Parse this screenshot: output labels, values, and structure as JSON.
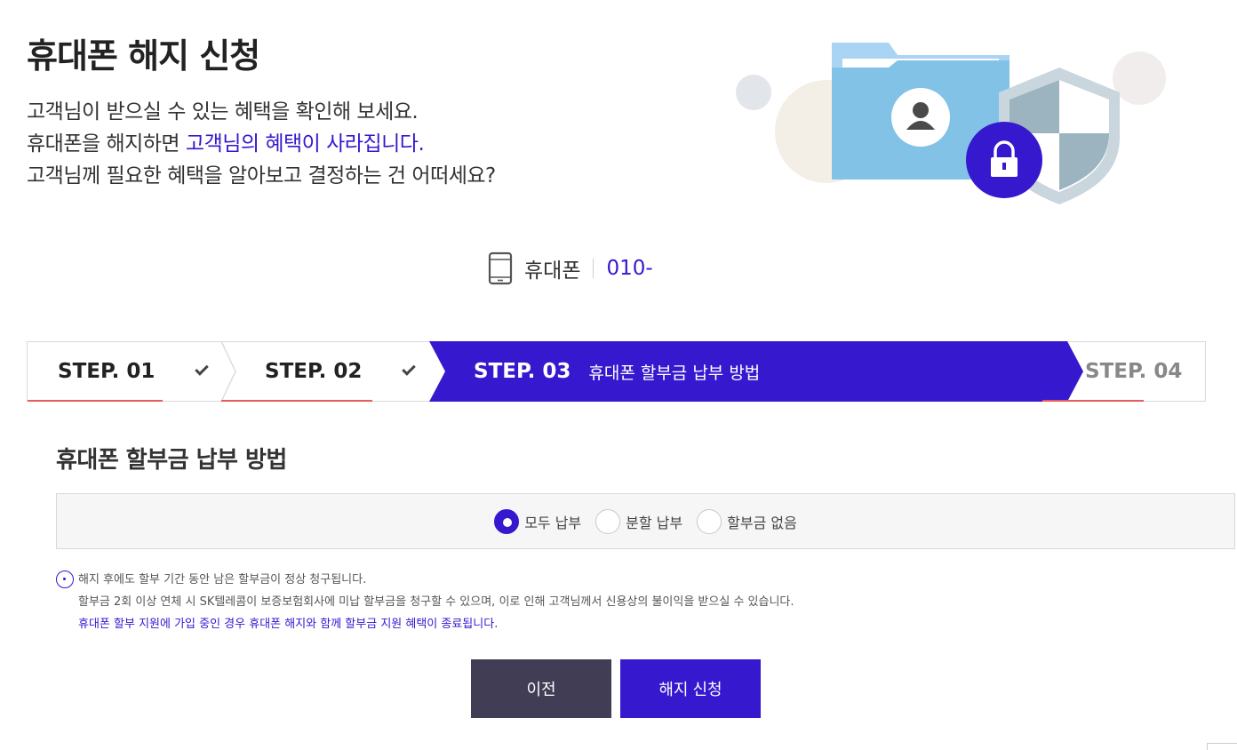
{
  "page": {
    "title": "휴대폰 해지 신청"
  },
  "intro": {
    "line1": "고객님이 받으실 수 있는 혜택을 확인해 보세요.",
    "line2_prefix": "휴대폰을 해지하면 ",
    "line2_highlight": "고객님의 혜택이 사라집니다.",
    "line3": "고객님께 필요한 혜택을 알아보고 결정하는 건 어떠세요?"
  },
  "line_info": {
    "icon": "mobile-phone-icon",
    "label": "휴대폰",
    "number": "010-"
  },
  "steps": [
    {
      "num": "STEP. 01",
      "state": "done"
    },
    {
      "num": "STEP. 02",
      "state": "done"
    },
    {
      "num": "STEP. 03",
      "state": "active",
      "desc": "휴대폰 할부금 납부 방법"
    },
    {
      "num": "STEP. 04",
      "state": "pending"
    }
  ],
  "section": {
    "title": "휴대폰 할부금 납부 방법"
  },
  "payment_options": {
    "selected": "모두 납부",
    "options": [
      "모두 납부",
      "분할 납부",
      "할부금 없음"
    ]
  },
  "notice": {
    "icon": "info-dot-icon",
    "line1": "해지 후에도 할부 기간 동안 남은 할부금이 정상 청구됩니다.",
    "line2": "할부금 2회 이상 연체 시 SK텔레콤이 보증보험회사에 미납 할부금을 청구할 수 있으며, 이로 인해 고객님께서 신용상의 불이익을 받으실 수 있습니다.",
    "line3": "휴대폰 할부 지원에 가입 중인 경우 휴대폰 해지와 함께 할부금 지원 혜택이 종료됩니다."
  },
  "buttons": {
    "prev": "이전",
    "submit": "해지 신청"
  },
  "colors": {
    "accent": "#3618ce",
    "dark_button": "#413d54",
    "step_underline": "#e95a5a"
  }
}
